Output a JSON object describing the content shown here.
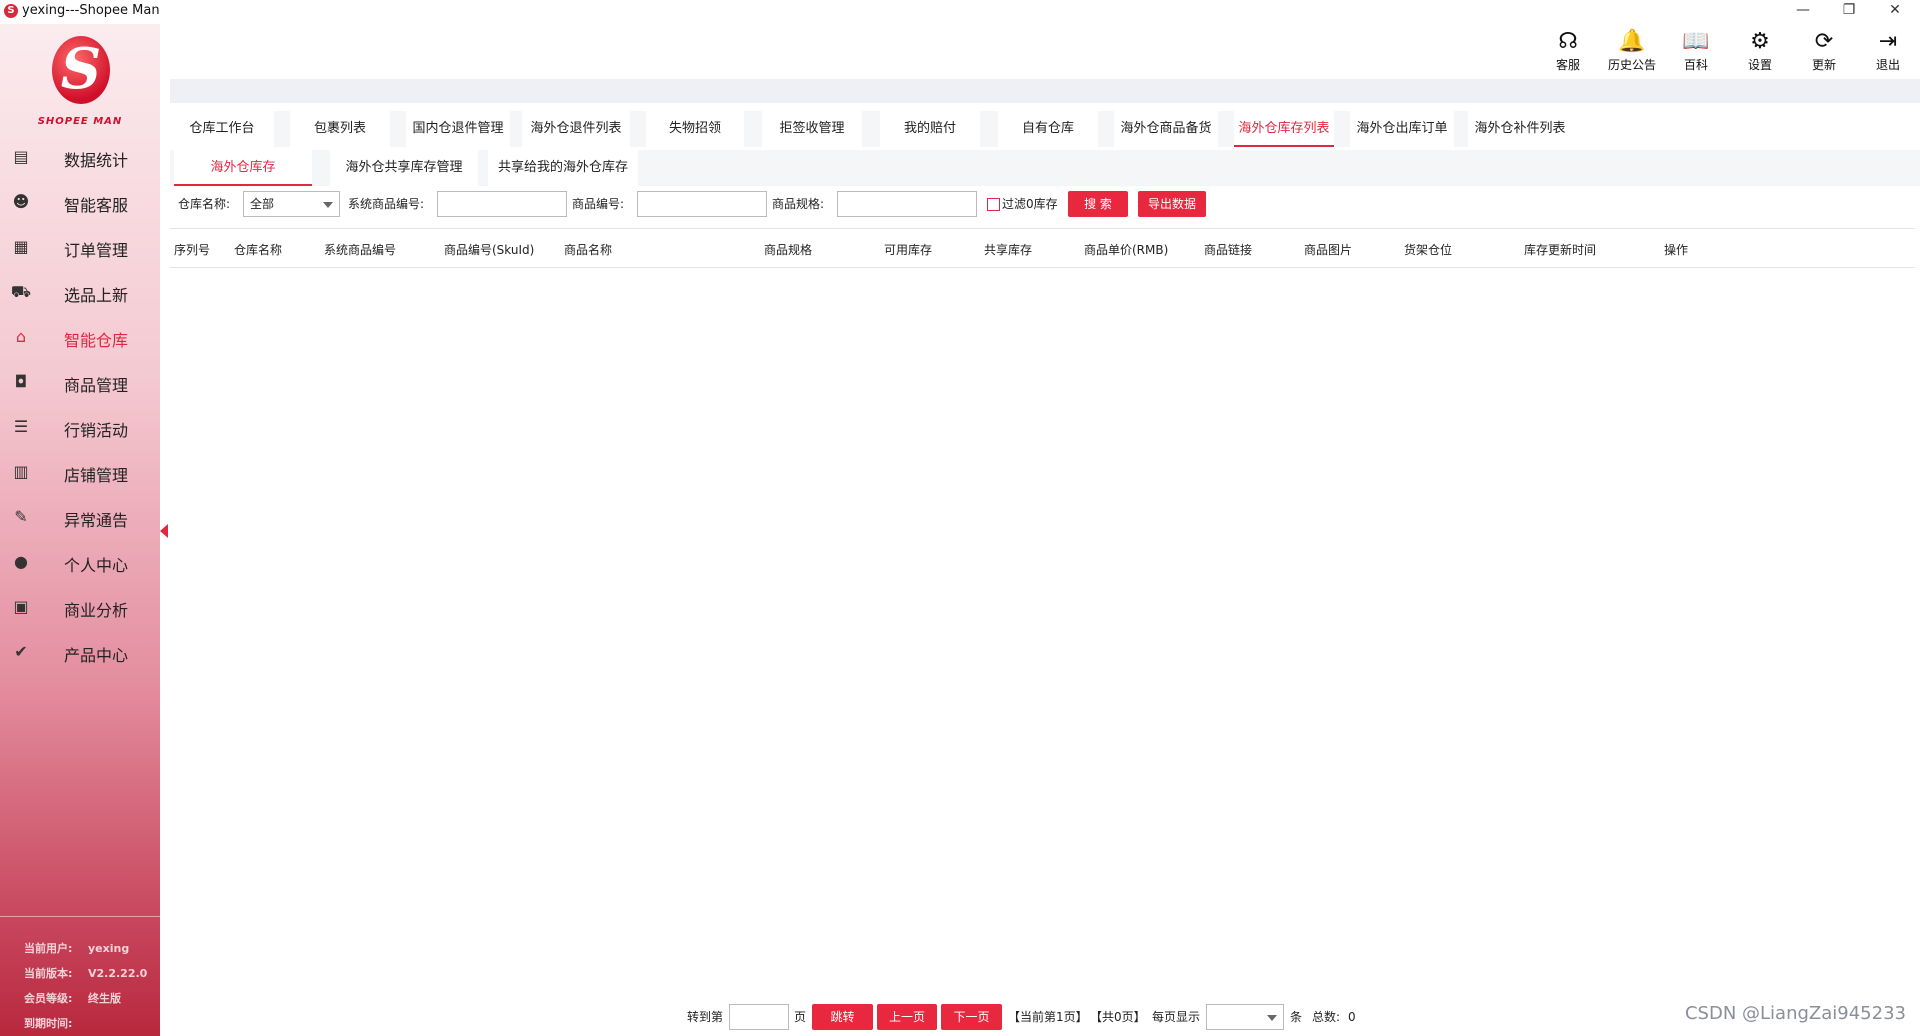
{
  "window": {
    "title": "yexing---Shopee Man",
    "logo_glyph": "S",
    "minimize": "—",
    "restore": "❐",
    "close": "✕"
  },
  "sidebar": {
    "logo_glyph": "S",
    "brand": "SHOPEE MAN",
    "items": [
      {
        "label": "数据统计",
        "icon": "chart-icon",
        "glyph": "▤"
      },
      {
        "label": "智能客服",
        "icon": "customer-service-icon",
        "glyph": "☻"
      },
      {
        "label": "订单管理",
        "icon": "document-icon",
        "glyph": "▦"
      },
      {
        "label": "选品上新",
        "icon": "cart-icon",
        "glyph": "⛟"
      },
      {
        "label": "智能仓库",
        "icon": "warehouse-icon",
        "glyph": "⌂"
      },
      {
        "label": "商品管理",
        "icon": "bag-icon",
        "glyph": "◘"
      },
      {
        "label": "行销活动",
        "icon": "list-icon",
        "glyph": "☰"
      },
      {
        "label": "店铺管理",
        "icon": "store-icon",
        "glyph": "▥"
      },
      {
        "label": "异常通告",
        "icon": "alert-doc-icon",
        "glyph": "✎"
      },
      {
        "label": "个人中心",
        "icon": "user-icon",
        "glyph": "●"
      },
      {
        "label": "商业分析",
        "icon": "monitor-icon",
        "glyph": "▣"
      },
      {
        "label": "产品中心",
        "icon": "product-icon",
        "glyph": "✔"
      }
    ],
    "active_index": 4,
    "info": {
      "user_key": "当前用户:",
      "user_val": "yexing",
      "version_key": "当前版本:",
      "version_val": "V2.2.22.0",
      "level_key": "会员等级:",
      "level_val": "终生版",
      "expire_key": "到期时间:",
      "expire_val": ""
    }
  },
  "toolbar": [
    {
      "label": "客服",
      "icon": "headset-icon",
      "glyph": "☊"
    },
    {
      "label": "历史公告",
      "icon": "bell-icon",
      "glyph": "🔔"
    },
    {
      "label": "百科",
      "icon": "book-icon",
      "glyph": "📖"
    },
    {
      "label": "设置",
      "icon": "gear-icon",
      "glyph": "⚙"
    },
    {
      "label": "更新",
      "icon": "refresh-icon",
      "glyph": "⟳"
    },
    {
      "label": "退出",
      "icon": "logout-icon",
      "glyph": "⇥"
    }
  ],
  "tabs_main": [
    "仓库工作台",
    "包裹列表",
    "国内仓退件管理",
    "海外仓退件列表",
    "失物招领",
    "拒签收管理",
    "我的赔付",
    "自有仓库",
    "海外仓商品备货",
    "海外仓库存列表",
    "海外仓出库订单",
    "海外仓补件列表"
  ],
  "tabs_main_active": 9,
  "tabs_sub": [
    "海外仓库存",
    "海外仓共享库存管理",
    "共享给我的海外仓库存"
  ],
  "tabs_sub_active": 0,
  "filter": {
    "warehouse_label": "仓库名称:",
    "warehouse_value": "全部",
    "sys_code_label": "系统商品编号:",
    "product_code_label": "商品编号:",
    "spec_label": "商品规格:",
    "filter_zero_label": "过滤0库存",
    "search_label": "搜 索",
    "export_label": "导出数据"
  },
  "table": {
    "columns": [
      "序列号",
      "仓库名称",
      "系统商品编号",
      "商品编号(SkuId)",
      "商品名称",
      "商品规格",
      "可用库存",
      "共享库存",
      "商品单价(RMB)",
      "商品链接",
      "商品图片",
      "货架仓位",
      "库存更新时间",
      "操作"
    ],
    "rows": []
  },
  "pagination": {
    "goto_label": "转到第",
    "page_unit": "页",
    "jump_label": "跳转",
    "prev_label": "上一页",
    "next_label": "下一页",
    "current_label": "【当前第1页】",
    "total_pages_label": "【共0页】",
    "per_page_label": "每页显示",
    "per_page_unit": "条",
    "total_label": "总数:",
    "total_value": "0"
  },
  "watermark": "CSDN @LiangZai945233"
}
